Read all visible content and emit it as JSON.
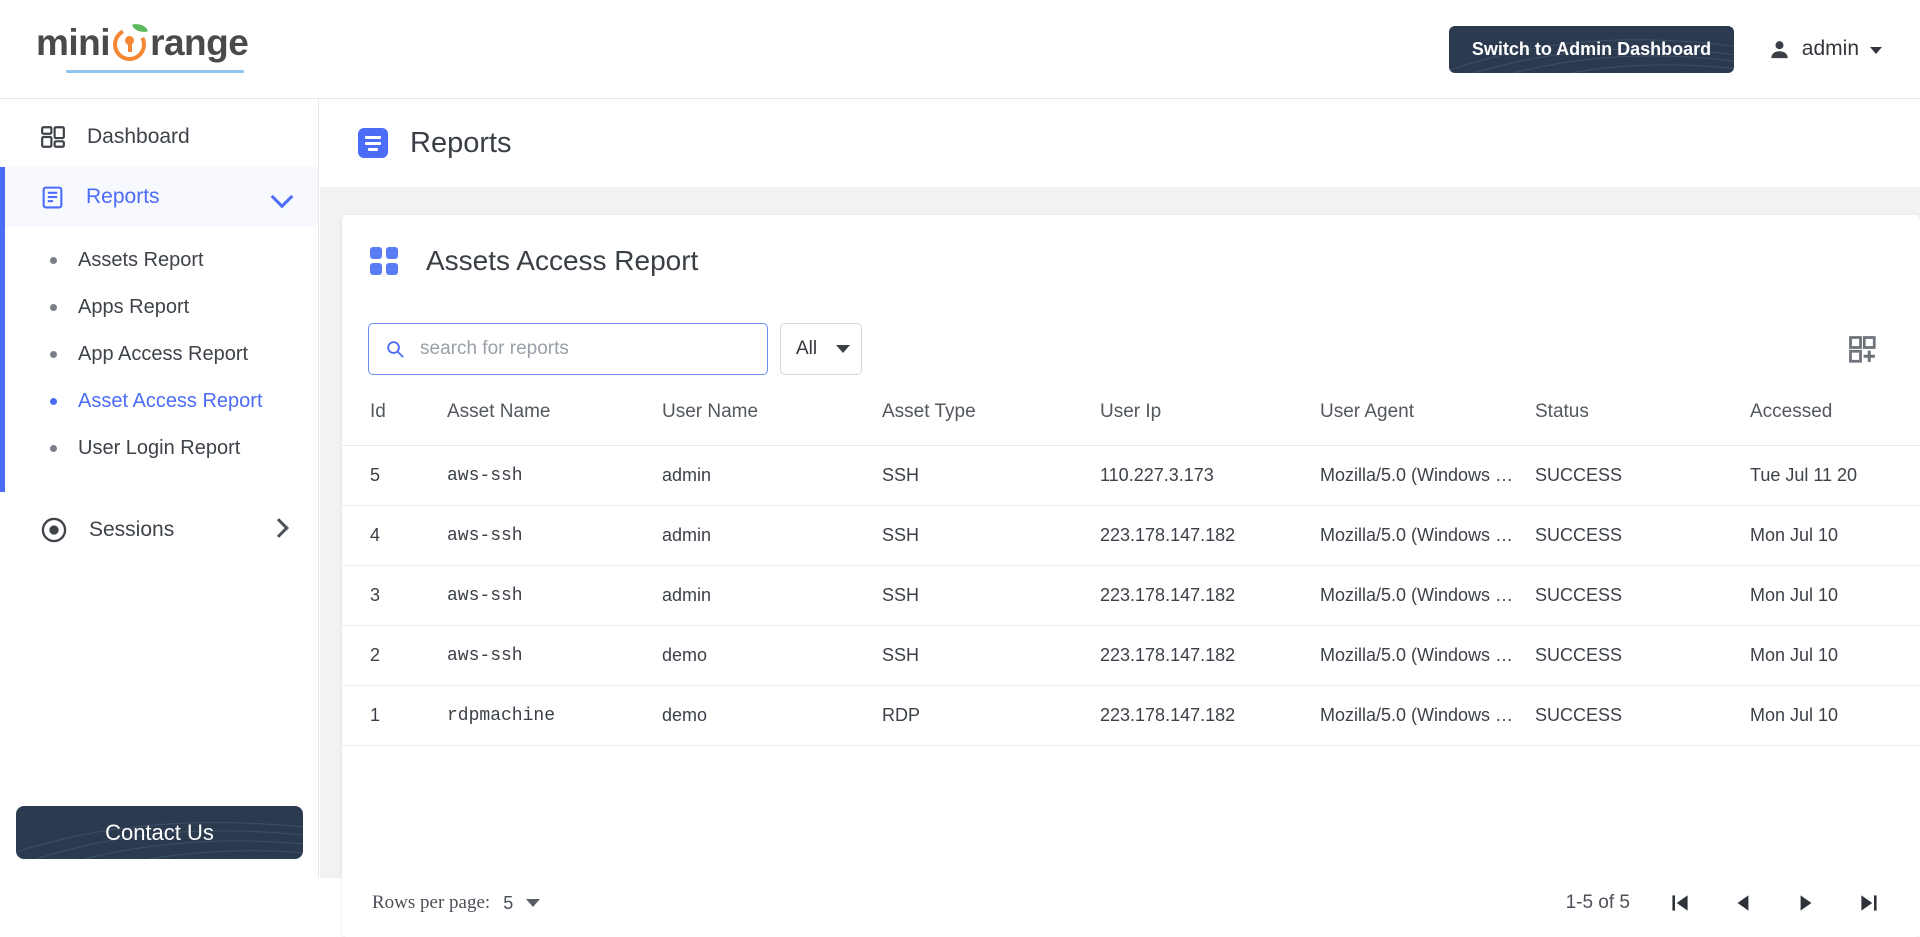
{
  "topbar": {
    "logo": {
      "part1": "mini",
      "part2": "range",
      "icon": "orange-keyhole-icon"
    },
    "admin_button": "Switch to Admin Dashboard",
    "user": {
      "name": "admin",
      "icon": "person-icon",
      "caret": "caret-down-icon"
    }
  },
  "sidebar": {
    "dashboard": {
      "label": "Dashboard",
      "icon": "dashboard-grid-icon"
    },
    "reports": {
      "label": "Reports",
      "icon": "reports-doc-icon",
      "chevron": "chevron-down-icon"
    },
    "report_children": [
      {
        "label": "Assets Report",
        "active": false
      },
      {
        "label": "Apps Report",
        "active": false
      },
      {
        "label": "App Access Report",
        "active": false
      },
      {
        "label": "Asset Access Report",
        "active": true
      },
      {
        "label": "User Login Report",
        "active": false
      }
    ],
    "sessions": {
      "label": "Sessions",
      "icon": "circle-dot-icon",
      "chevron": "chevron-right-icon"
    },
    "contact_button": "Contact Us"
  },
  "page": {
    "title": "Reports",
    "icon": "report-lines-icon"
  },
  "card": {
    "title": "Assets Access Report",
    "icon": "four-squares-icon",
    "search": {
      "placeholder": "search for reports",
      "value": ""
    },
    "filter": {
      "selected": "All"
    },
    "column_button_icon": "add-column-icon",
    "columns": [
      "Id",
      "Asset Name",
      "User Name",
      "Asset Type",
      "User Ip",
      "User Agent",
      "Status",
      "Accessed"
    ],
    "rows": [
      {
        "id": "5",
        "asset_name": "aws-ssh",
        "user_name": "admin",
        "asset_type": "SSH",
        "user_ip": "110.227.3.173",
        "user_agent": "Mozilla/5.0 (Windows …",
        "status": "SUCCESS",
        "accessed": "Tue Jul 11 20"
      },
      {
        "id": "4",
        "asset_name": "aws-ssh",
        "user_name": "admin",
        "asset_type": "SSH",
        "user_ip": "223.178.147.182",
        "user_agent": "Mozilla/5.0 (Windows …",
        "status": "SUCCESS",
        "accessed": "Mon Jul 10"
      },
      {
        "id": "3",
        "asset_name": "aws-ssh",
        "user_name": "admin",
        "asset_type": "SSH",
        "user_ip": "223.178.147.182",
        "user_agent": "Mozilla/5.0 (Windows …",
        "status": "SUCCESS",
        "accessed": "Mon Jul 10"
      },
      {
        "id": "2",
        "asset_name": "aws-ssh",
        "user_name": "demo",
        "asset_type": "SSH",
        "user_ip": "223.178.147.182",
        "user_agent": "Mozilla/5.0 (Windows …",
        "status": "SUCCESS",
        "accessed": "Mon Jul 10"
      },
      {
        "id": "1",
        "asset_name": "rdpmachine",
        "user_name": "demo",
        "asset_type": "RDP",
        "user_ip": "223.178.147.182",
        "user_agent": "Mozilla/5.0 (Windows …",
        "status": "SUCCESS",
        "accessed": "Mon Jul 10"
      }
    ],
    "footer": {
      "rows_per_page_label": "Rows per page:",
      "rows_per_page_value": "5",
      "range": "1-5 of 5",
      "first_icon": "first-page-icon",
      "prev_icon": "previous-page-icon",
      "next_icon": "next-page-icon",
      "last_icon": "last-page-icon"
    }
  },
  "colors": {
    "accent_blue": "#4a6cf7",
    "navy": "#2b3a4f",
    "success_green": "#2e8b63",
    "orange": "#f58634",
    "page_bg": "#f1f2f3"
  }
}
